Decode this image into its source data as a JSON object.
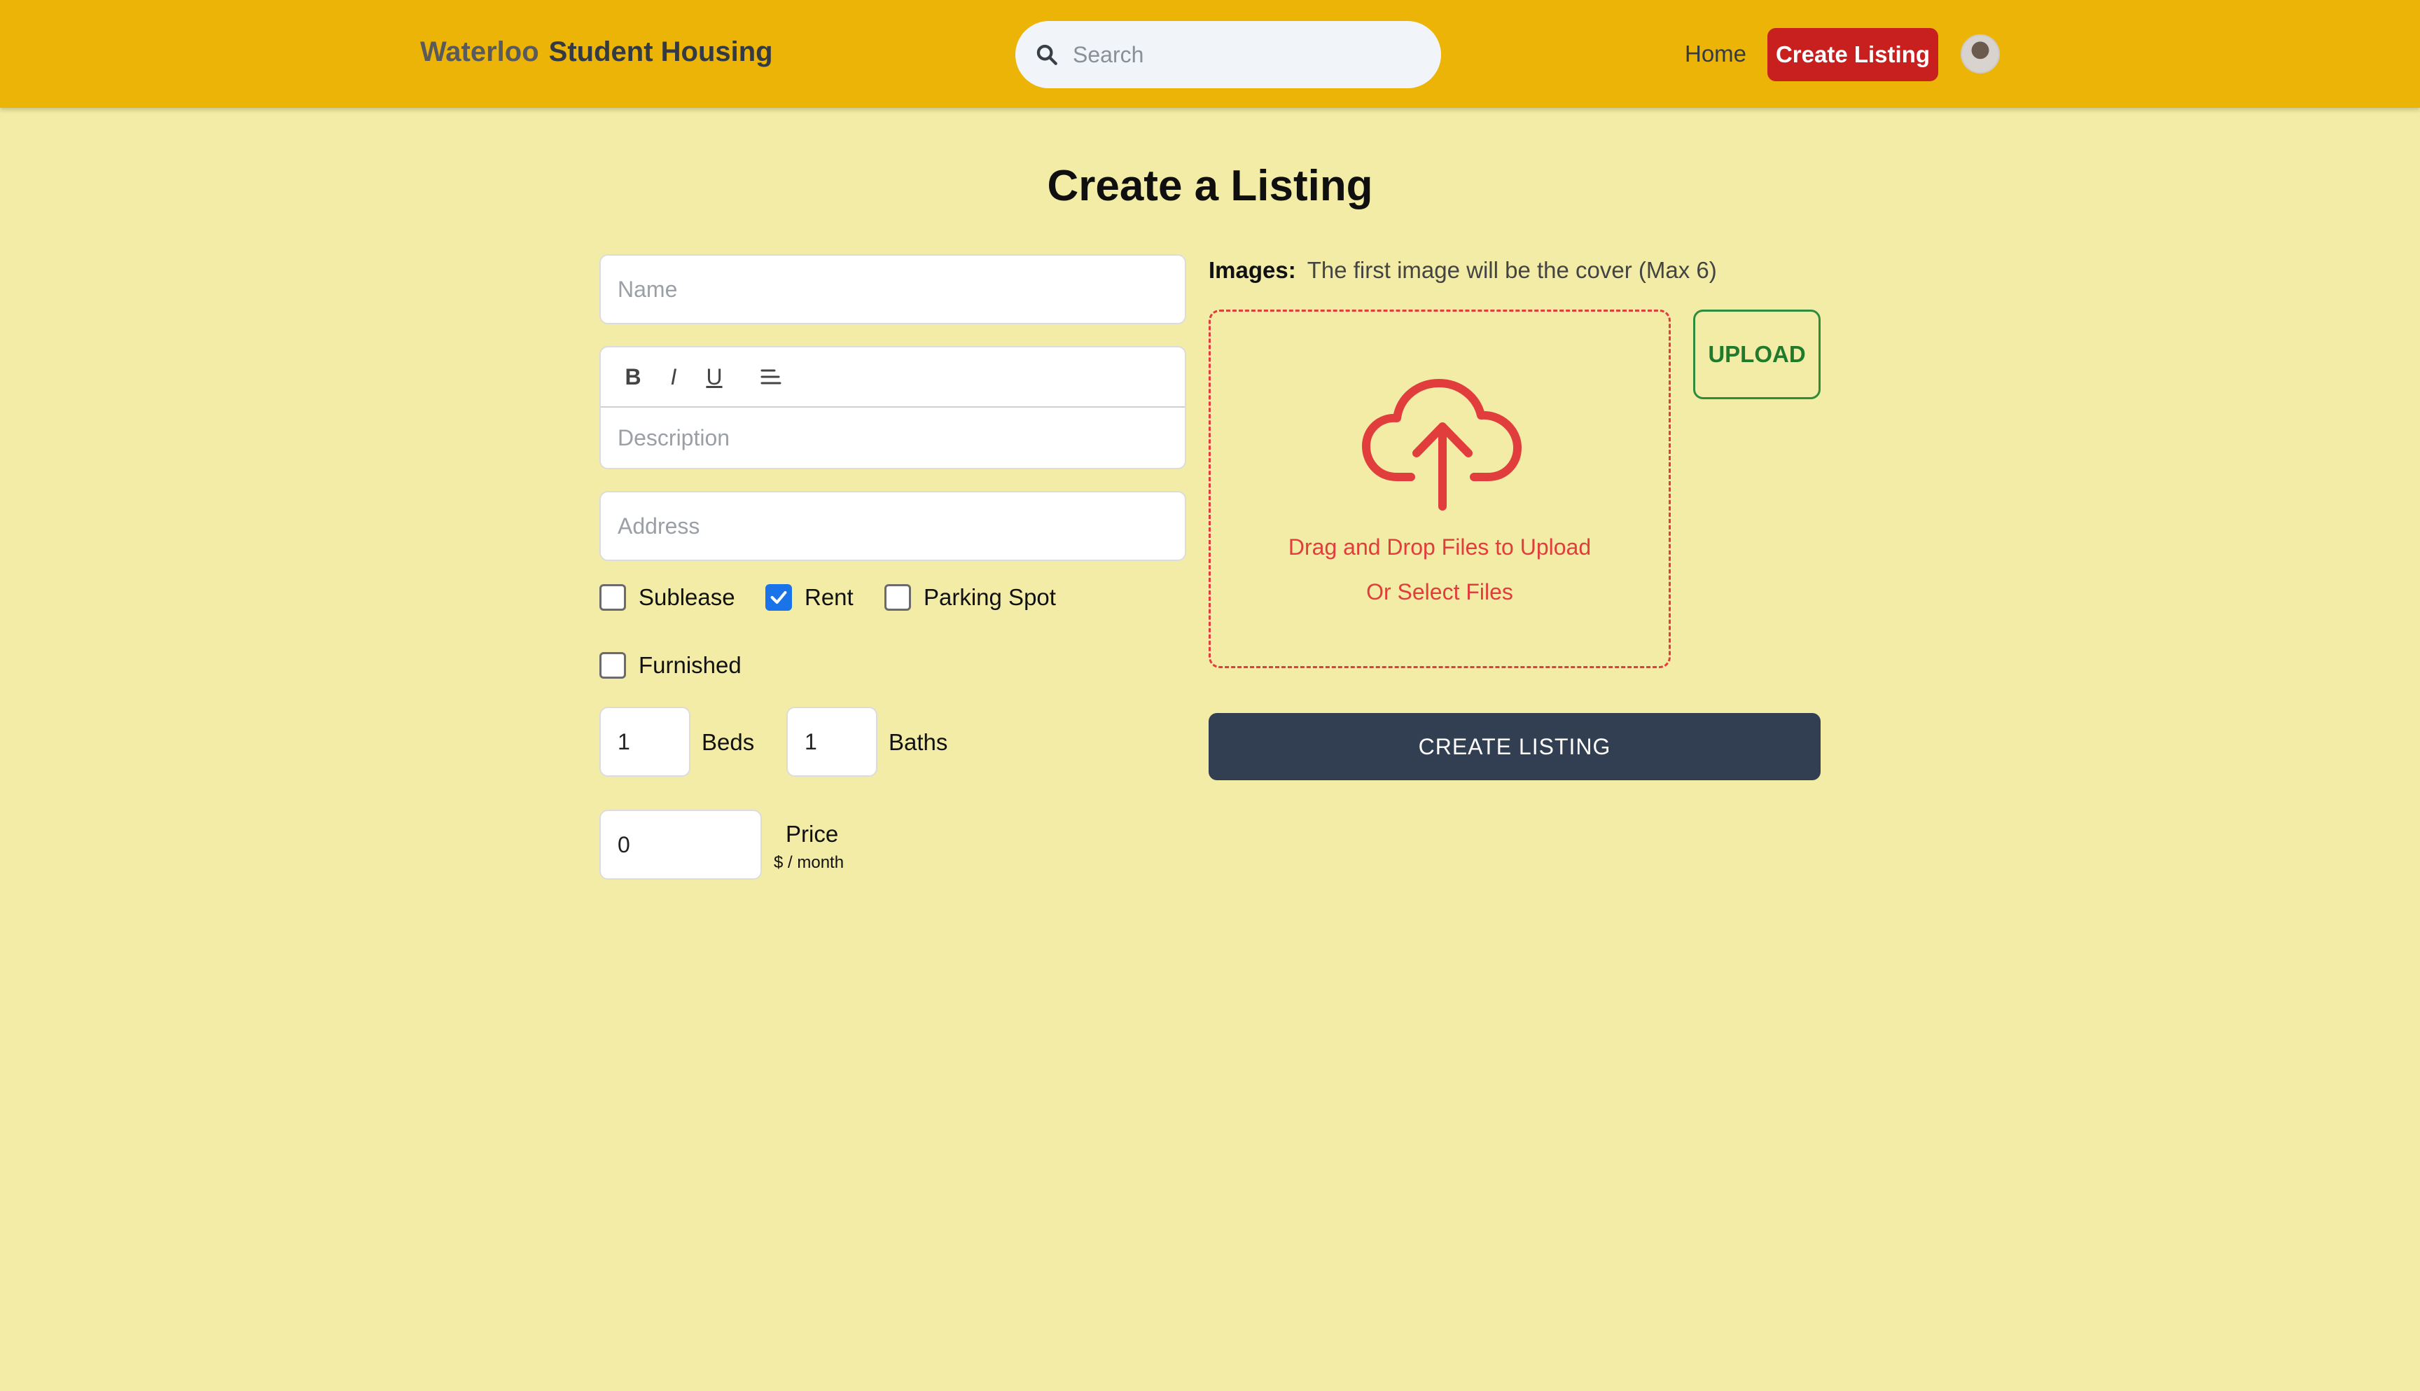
{
  "header": {
    "brand_part1": "Waterloo",
    "brand_part2": "Student Housing",
    "search_placeholder": "Search",
    "nav_home": "Home",
    "nav_create": "Create Listing"
  },
  "page": {
    "title": "Create a Listing"
  },
  "form": {
    "name_placeholder": "Name",
    "description_placeholder": "Description",
    "address_placeholder": "Address",
    "toolbar": {
      "bold": "B",
      "italic": "I",
      "underline": "U"
    },
    "checkboxes": [
      {
        "label": "Sublease",
        "checked": false
      },
      {
        "label": "Rent",
        "checked": true
      },
      {
        "label": "Parking Spot",
        "checked": false
      },
      {
        "label": "Furnished",
        "checked": false
      }
    ],
    "beds_value": "1",
    "beds_label": "Beds",
    "baths_value": "1",
    "baths_label": "Baths",
    "price_value": "0",
    "price_label": "Price",
    "price_unit": "$ / month"
  },
  "images": {
    "label_bold": "Images:",
    "label_text": "The first image will be the cover (Max 6)",
    "drop_text": "Drag and Drop Files to Upload",
    "select_text": "Or Select Files",
    "upload_button": "UPLOAD"
  },
  "actions": {
    "create_listing": "CREATE LISTING"
  },
  "colors": {
    "header_bg": "#ebb406",
    "page_bg": "#f2eca6",
    "accent_red": "#c8201f",
    "upload_green": "#1f7a2c",
    "create_btn": "#323f52"
  }
}
